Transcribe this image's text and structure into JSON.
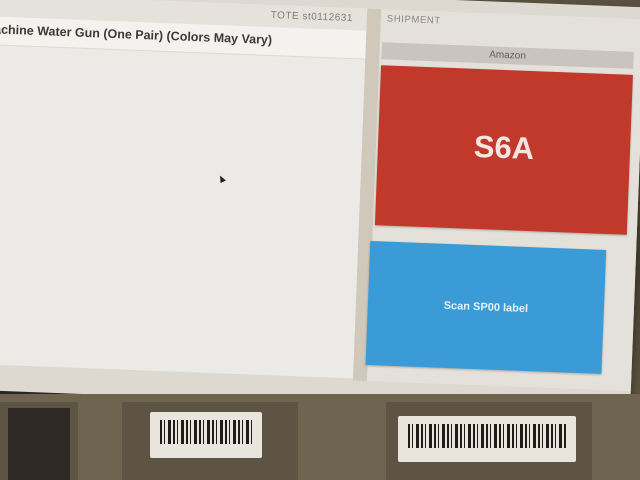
{
  "tote": {
    "label": "TOTE st0112631"
  },
  "item": {
    "title": "achine Water Gun (One Pair) (Colors May Vary)"
  },
  "shipment": {
    "header": "SHIPMENT",
    "carrier": "Amazon",
    "sort_code": "S6A",
    "scan_prompt": "Scan SP00 label",
    "colors": {
      "sort_tile": "#c0392b",
      "scan_tile": "#3a9bd6"
    }
  }
}
